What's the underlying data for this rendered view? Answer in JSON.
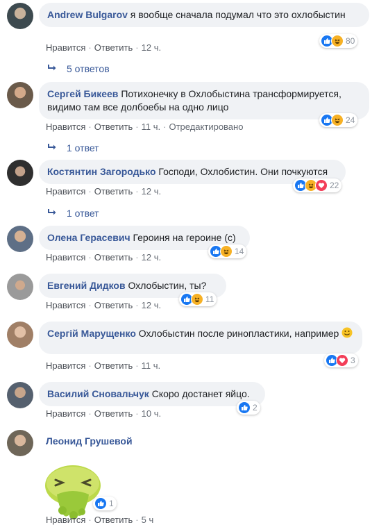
{
  "actions": {
    "like": "Нравится",
    "reply": "Ответить",
    "edited": "Отредактировано"
  },
  "comments": [
    {
      "name": "Andrew Bulgarov",
      "text": "я вообще сначала подумал что это охлобыстин",
      "time": "12 ч.",
      "reactions": [
        "like",
        "haha"
      ],
      "count": "80",
      "replies": "5 ответов"
    },
    {
      "name": "Сергей Бикеев",
      "text": "Потихонечку в Охлобыстина трансформируется, видимо там все долбоебы на одно лицо",
      "time": "11 ч.",
      "reactions": [
        "like",
        "haha"
      ],
      "count": "24",
      "replies": "1 ответ"
    },
    {
      "name": "Костянтин Загородько",
      "text": "Господи, Охлобистин. Они почкуются",
      "time": "12 ч.",
      "reactions": [
        "like",
        "haha",
        "love"
      ],
      "count": "22",
      "replies": "1 ответ"
    },
    {
      "name": "Олена Герасевич",
      "text": "Героиня на героине (c)",
      "time": "12 ч.",
      "reactions": [
        "like",
        "haha"
      ],
      "count": "14"
    },
    {
      "name": "Евгений Дидков",
      "text": "Охлобыстин, ты?",
      "time": "12 ч.",
      "reactions": [
        "like",
        "haha"
      ],
      "count": "11"
    },
    {
      "name": "Сергій Марущенко",
      "text": "Охлобыстин после ринопластики, например",
      "time": "11 ч.",
      "reactions": [
        "like",
        "love"
      ],
      "count": "3"
    },
    {
      "name": "Василий Сновальчук",
      "text": "Скоро достанет яйцо.",
      "time": "10 ч.",
      "reactions": [
        "like"
      ],
      "count": "2"
    },
    {
      "name": "Леонид Грушевой",
      "text": "",
      "time": "5 ч",
      "reactions": [
        "like"
      ],
      "count": "1"
    }
  ],
  "icons": {
    "like": "thumbs-up-icon",
    "haha": "laughing-face-icon",
    "love": "heart-icon",
    "reply_arrow": "reply-arrow-icon",
    "smiley": "smiley-emoji-icon",
    "sticker": "vomiting-face-sticker"
  },
  "colors": {
    "link": "#385898",
    "like": "#1877f2",
    "haha": "#f7b125",
    "love": "#f33e58",
    "bubble": "#f0f2f5"
  }
}
